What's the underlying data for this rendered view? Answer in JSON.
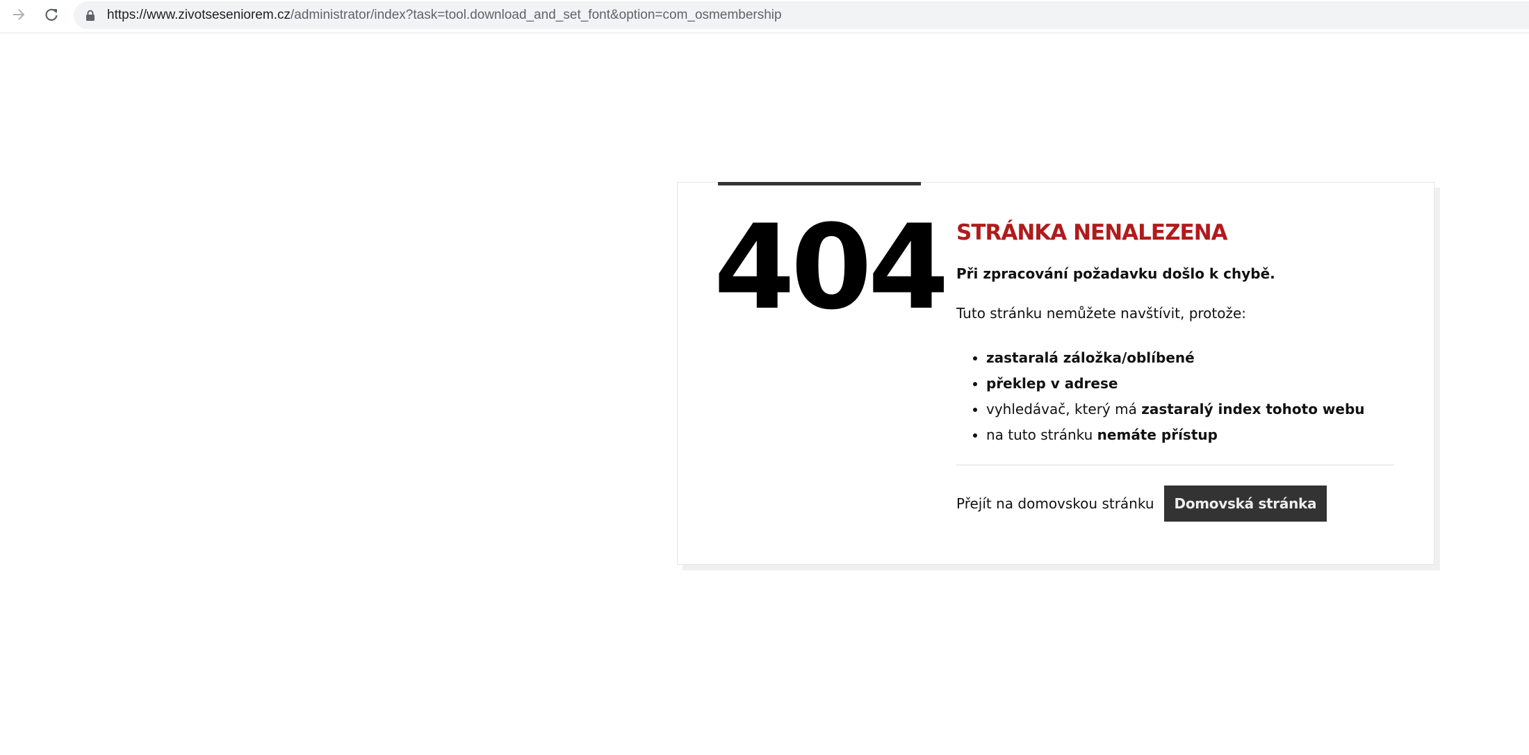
{
  "browser": {
    "url_host": "https://www.zivotseseniorem.cz",
    "url_path": "/administrator/index?task=tool.download_and_set_font&option=com_osmembership",
    "icons": [
      "forward-arrow-icon",
      "reload-icon",
      "lock-icon"
    ]
  },
  "error": {
    "code": "404",
    "title": "STRÁNKA NENALEZENA",
    "lead": "Při zpracování požadavku došlo k chybě.",
    "intro": "Tuto stránku nemůžete navštívit, protože:",
    "reasons": [
      {
        "plain": "",
        "bold": "zastaralá záložka/oblíbené"
      },
      {
        "plain": "",
        "bold": "překlep v adrese"
      },
      {
        "plain": "vyhledávač, který má ",
        "bold": "zastaralý index tohoto webu"
      },
      {
        "plain": "na tuto stránku ",
        "bold": "nemáte přístup"
      }
    ],
    "footer_text": "Přejít na domovskou stránku",
    "home_button": "Domovská stránka"
  },
  "colors": {
    "title_red": "#b01b1b",
    "button_bg": "#333333",
    "accent_line": "#333333"
  }
}
